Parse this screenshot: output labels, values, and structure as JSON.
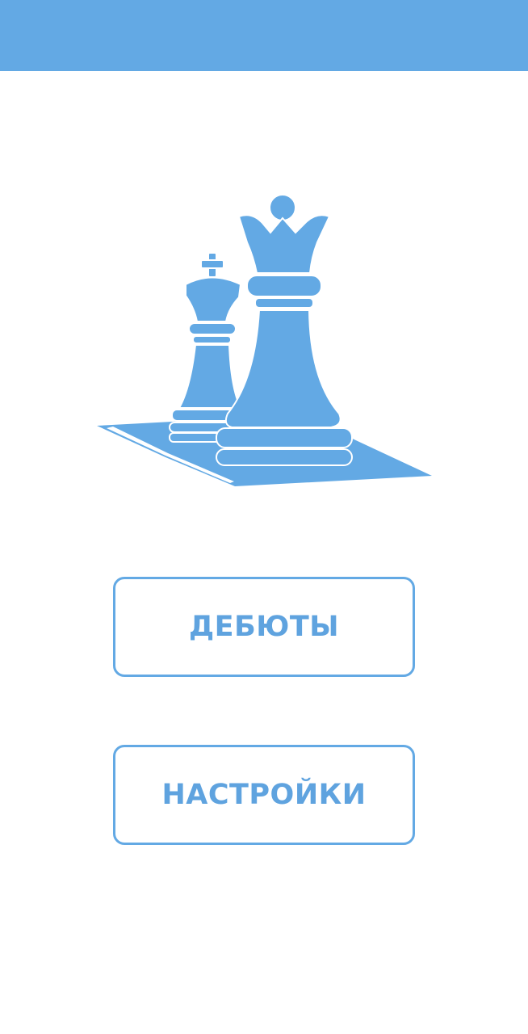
{
  "theme": {
    "accent": "#63a9e4",
    "button_text": "#5fa3df",
    "background": "#ffffff"
  },
  "header": {
    "title": ""
  },
  "logo": {
    "icon": "chess-king-queen-board-icon"
  },
  "menu": {
    "openings_label": "ДЕБЮТЫ",
    "settings_label": "НАСТРОЙКИ"
  }
}
